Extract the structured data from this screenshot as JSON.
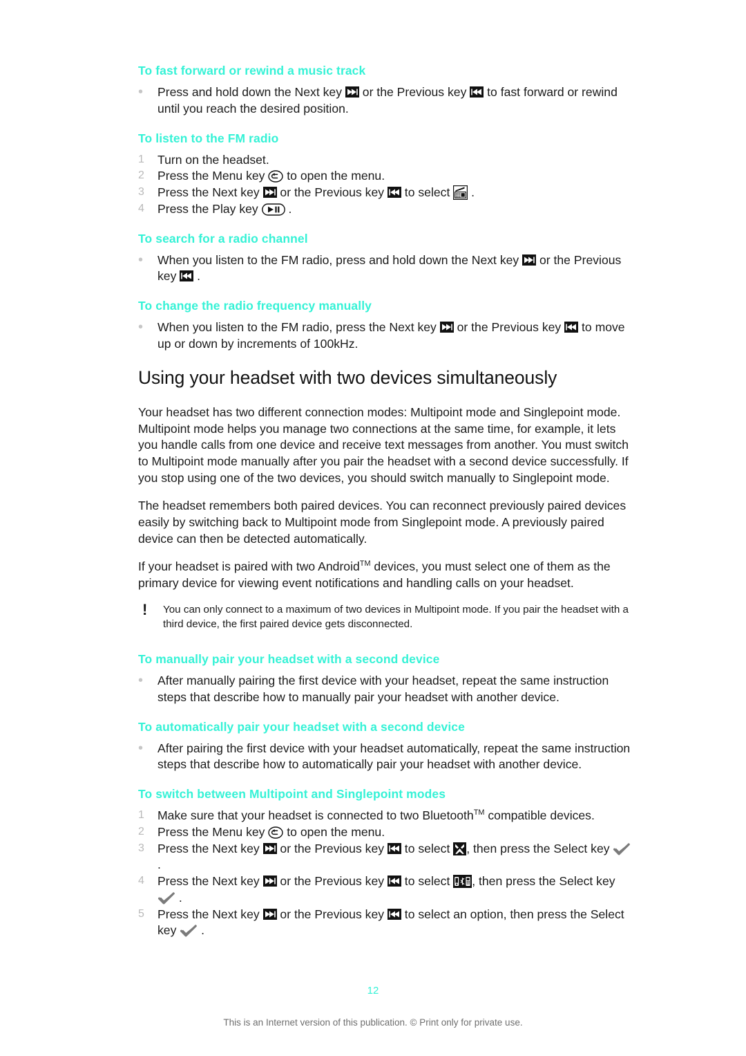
{
  "page": {
    "number": "12",
    "footer_note": "This is an Internet version of this publication. © Print only for private use."
  },
  "sections": [
    {
      "heading": "To fast forward or rewind a music track",
      "items": [
        {
          "marker": "•",
          "parts": [
            {
              "t": "text",
              "v": "Press and hold down the Next key "
            },
            {
              "t": "icon",
              "v": "next-key-icon"
            },
            {
              "t": "text",
              "v": " or the Previous key "
            },
            {
              "t": "icon",
              "v": "previous-key-icon"
            },
            {
              "t": "text",
              "v": " to fast forward or rewind until you reach the desired position."
            }
          ]
        }
      ]
    },
    {
      "heading": "To listen to the FM radio",
      "items": [
        {
          "marker": "1",
          "parts": [
            {
              "t": "text",
              "v": "Turn on the headset."
            }
          ]
        },
        {
          "marker": "2",
          "parts": [
            {
              "t": "text",
              "v": "Press the Menu key "
            },
            {
              "t": "icon",
              "v": "menu-key-icon"
            },
            {
              "t": "text",
              "v": " to open the menu."
            }
          ]
        },
        {
          "marker": "3",
          "parts": [
            {
              "t": "text",
              "v": "Press the Next key "
            },
            {
              "t": "icon",
              "v": "next-key-icon"
            },
            {
              "t": "text",
              "v": " or the Previous key "
            },
            {
              "t": "icon",
              "v": "previous-key-icon"
            },
            {
              "t": "text",
              "v": " to select "
            },
            {
              "t": "icon",
              "v": "fm-radio-icon"
            },
            {
              "t": "text",
              "v": " ."
            }
          ]
        },
        {
          "marker": "4",
          "parts": [
            {
              "t": "text",
              "v": "Press the Play key "
            },
            {
              "t": "icon",
              "v": "play-pause-key-icon"
            },
            {
              "t": "text",
              "v": " ."
            }
          ]
        }
      ]
    },
    {
      "heading": "To search for a radio channel",
      "items": [
        {
          "marker": "•",
          "parts": [
            {
              "t": "text",
              "v": "When you listen to the FM radio, press and hold down the Next key "
            },
            {
              "t": "icon",
              "v": "next-key-icon"
            },
            {
              "t": "text",
              "v": " or the Previous key "
            },
            {
              "t": "icon",
              "v": "previous-key-icon"
            },
            {
              "t": "text",
              "v": " ."
            }
          ]
        }
      ]
    },
    {
      "heading": "To change the radio frequency manually",
      "items": [
        {
          "marker": "•",
          "parts": [
            {
              "t": "text",
              "v": "When you listen to the FM radio, press the Next key "
            },
            {
              "t": "icon",
              "v": "next-key-icon"
            },
            {
              "t": "text",
              "v": " or the Previous key "
            },
            {
              "t": "icon",
              "v": "previous-key-icon"
            },
            {
              "t": "text",
              "v": " to move up or down by increments of 100kHz."
            }
          ]
        }
      ]
    }
  ],
  "main_section": {
    "title": "Using your headset with two devices simultaneously",
    "paragraphs": [
      "Your headset has two different connection modes: Multipoint mode and Singlepoint mode. Multipoint mode helps you manage two connections at the same time, for example, it lets you handle calls from one device and receive text messages from another. You must switch to Multipoint mode manually after you pair the headset with a second device successfully. If you stop using one of the two devices, you should switch manually to Singlepoint mode.",
      "The headset remembers both paired devices. You can reconnect previously paired devices easily by switching back to Multipoint mode from Singlepoint mode. A previously paired device can then be detected automatically."
    ],
    "android_paragraph": {
      "before": "If your headset is paired with two Android",
      "tm": "TM",
      "after": " devices, you must select one of them as the primary device for viewing event notifications and handling calls on your headset."
    },
    "note": {
      "icon": "exclamation-icon",
      "text": "You can only connect to a maximum of two devices in Multipoint mode. If you pair the headset with a third device, the first paired device gets disconnected."
    }
  },
  "sections2": [
    {
      "heading": "To manually pair your headset with a second device",
      "items": [
        {
          "marker": "•",
          "parts": [
            {
              "t": "text",
              "v": "After manually pairing the first device with your headset, repeat the same instruction steps that describe how to manually pair your headset with another device."
            }
          ]
        }
      ]
    },
    {
      "heading": "To automatically pair your headset with a second device",
      "items": [
        {
          "marker": "•",
          "parts": [
            {
              "t": "text",
              "v": "After pairing the first device with your headset automatically, repeat the same instruction steps that describe how to automatically pair your headset with another device."
            }
          ]
        }
      ]
    },
    {
      "heading": "To switch between Multipoint and Singlepoint modes",
      "items": [
        {
          "marker": "1",
          "parts": [
            {
              "t": "text",
              "v": "Make sure that your headset is connected to two Bluetooth"
            },
            {
              "t": "tm",
              "v": "TM"
            },
            {
              "t": "text",
              "v": " compatible devices."
            }
          ]
        },
        {
          "marker": "2",
          "parts": [
            {
              "t": "text",
              "v": "Press the Menu key "
            },
            {
              "t": "icon",
              "v": "menu-key-icon"
            },
            {
              "t": "text",
              "v": " to open the menu."
            }
          ]
        },
        {
          "marker": "3",
          "parts": [
            {
              "t": "text",
              "v": "Press the Next key "
            },
            {
              "t": "icon",
              "v": "next-key-icon"
            },
            {
              "t": "text",
              "v": " or the Previous key "
            },
            {
              "t": "icon",
              "v": "previous-key-icon"
            },
            {
              "t": "text",
              "v": " to select "
            },
            {
              "t": "icon",
              "v": "settings-tools-icon"
            },
            {
              "t": "text",
              "v": ", then press the Select key "
            },
            {
              "t": "icon",
              "v": "check-select-key-icon"
            },
            {
              "t": "text",
              "v": " ."
            }
          ]
        },
        {
          "marker": "4",
          "parts": [
            {
              "t": "text",
              "v": "Press the Next key "
            },
            {
              "t": "icon",
              "v": "next-key-icon"
            },
            {
              "t": "text",
              "v": " or the Previous key "
            },
            {
              "t": "icon",
              "v": "previous-key-icon"
            },
            {
              "t": "text",
              "v": " to select "
            },
            {
              "t": "icon",
              "v": "multipoint-devices-icon"
            },
            {
              "t": "text",
              "v": ", then press the Select key "
            },
            {
              "t": "icon",
              "v": "check-select-key-icon"
            },
            {
              "t": "text",
              "v": " ."
            }
          ]
        },
        {
          "marker": "5",
          "parts": [
            {
              "t": "text",
              "v": "Press the Next key "
            },
            {
              "t": "icon",
              "v": "next-key-icon"
            },
            {
              "t": "text",
              "v": " or the Previous key "
            },
            {
              "t": "icon",
              "v": "previous-key-icon"
            },
            {
              "t": "text",
              "v": " to select an option, then press the Select key "
            },
            {
              "t": "icon",
              "v": "check-select-key-icon"
            },
            {
              "t": "text",
              "v": " ."
            }
          ]
        }
      ]
    }
  ],
  "colors": {
    "heading_cyan": "#35f2d6",
    "body_text": "#1a1a1a",
    "marker_gray": "#b9b9b9",
    "footer_gray": "#6e6e6e"
  }
}
